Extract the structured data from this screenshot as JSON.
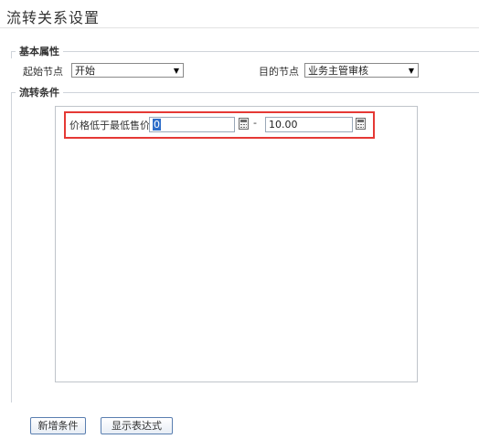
{
  "page": {
    "title": "流转关系设置"
  },
  "basic": {
    "heading": "基本属性",
    "start_label": "起始节点",
    "start_value": "开始",
    "target_label": "目的节点",
    "target_value": "业务主管审核"
  },
  "condition": {
    "heading": "流转条件",
    "label": "价格低于最低售价",
    "min_value": "0",
    "separator": "-",
    "max_value": "10.00"
  },
  "buttons": {
    "add_condition": "新增条件",
    "show_expression": "显示表达式"
  },
  "colors": {
    "highlight_border": "#e53935",
    "selection": "#2f6ec9",
    "button_border": "#5a7fb0"
  }
}
